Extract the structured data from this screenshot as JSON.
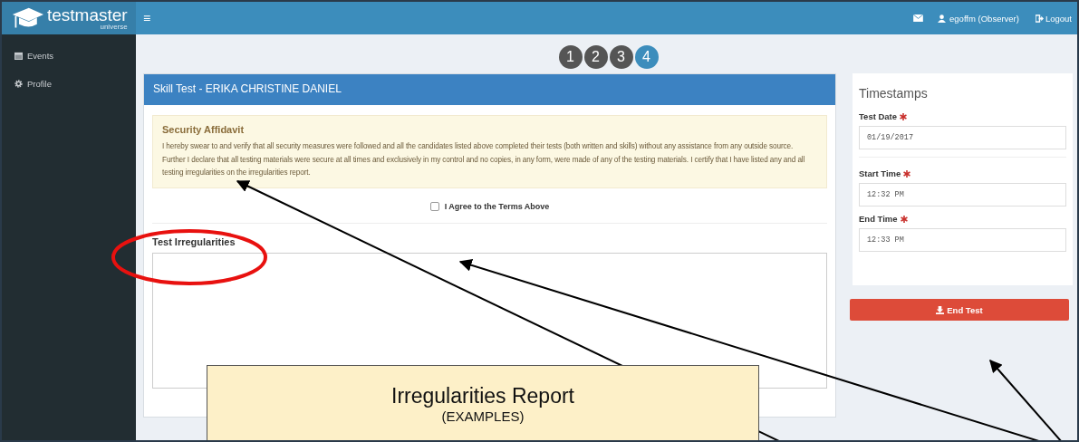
{
  "brand": {
    "name": "testmaster",
    "sub": "universe"
  },
  "topbar": {
    "menu": "≡",
    "user": "egoffm (Observer)",
    "logout": "Logout"
  },
  "sidebar": {
    "items": [
      {
        "label": "Events",
        "kind": "calendar"
      },
      {
        "label": "Profile",
        "kind": "gear"
      }
    ]
  },
  "steps": [
    {
      "label": "1",
      "selected": false
    },
    {
      "label": "2",
      "selected": false
    },
    {
      "label": "3",
      "selected": false
    },
    {
      "label": "4",
      "selected": true
    }
  ],
  "panel": {
    "title": "Skill Test - ERIKA CHRISTINE DANIEL",
    "affidavit": {
      "title": "Security Affidavit",
      "text": "I hereby swear to and verify that all security measures were followed and all the candidates listed above completed their tests (both written and skills) without any assistance from any outside source. Further I declare that all testing materials were secure at all times and exclusively in my control and no copies, in any form, were made of any of the testing materials. I certify that I have listed any and all testing irregularities on the irregularities report."
    },
    "agree": {
      "label": "I Agree to the Terms Above",
      "checked": false
    },
    "irregularities": {
      "label": "Test Irregularities"
    }
  },
  "timestamps": {
    "title": "Timestamps",
    "date_fields": [
      {
        "label": "Test Date",
        "value": "01/19/2017"
      }
    ],
    "time_fields": [
      {
        "label": "Start Time",
        "value": "12:32 PM"
      },
      {
        "label": "End Time",
        "value": "12:33 PM"
      }
    ],
    "button": "End Test"
  },
  "callout": {
    "title": "Irregularities Report",
    "subtitle": "(EXAMPLES)"
  }
}
